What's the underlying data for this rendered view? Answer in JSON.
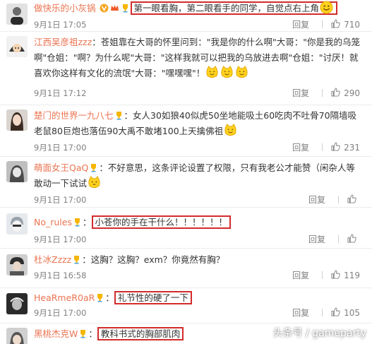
{
  "reply_label": "回复",
  "watermark": "头条号 / gameparty",
  "colors": {
    "username": "#eb7350",
    "highlight_box": "#d32b2b",
    "meta_text": "#808080"
  },
  "comments": [
    {
      "username": "做快乐的小灰锅",
      "separator": " ",
      "prefix": "",
      "text_part": "第一眼看胸，第二眼看手的同学，自觉点右上角",
      "text_rest": "",
      "time": "9月1日 17:05",
      "likes": "710"
    },
    {
      "username": "江西吴彦祖zzz",
      "separator": "：",
      "prefix": "",
      "text_part": "",
      "text_rest": "苍姐靠在大哥的怀里问到：\"我是你的什么啊\"大哥：\"你是我的乌笼啊\"仓姐：\"啊？为什么呢\"大哥：\"这样我就可以把我的乌放进去啊\"仓姐：\"讨厌！就喜欢你这样有文化的流氓\"大哥：\"嘿嘿嘿\"！",
      "time": "9月1日 17:12",
      "likes": "290"
    },
    {
      "username": "楚门的世界一九八七",
      "separator": "：",
      "prefix": "",
      "text_part": "",
      "text_rest": "女人30如狼40似虎50坐地能吸土60吃肉不吐骨70隔墙吸老鼠80巨炮也落伍90大禹不敢堵100上天擒佛祖",
      "time": "9月1日 17:00",
      "likes": "231"
    },
    {
      "username": "萌面女王QaQ",
      "separator": "：",
      "prefix": "",
      "text_part": "",
      "text_rest": "不好意思，这条评论设置了权限，只有我老公才能赞（闲杂人等敢动一下试试",
      "time": "9月1日 17:00",
      "likes": ""
    },
    {
      "username": "No_rules",
      "separator": "：",
      "prefix": "",
      "text_part": "小苍你的手在干什么！！！！！！",
      "text_rest": "",
      "time": "9月1日 17:00",
      "likes": ""
    },
    {
      "username": "杜冰Zzzz",
      "separator": "：",
      "prefix": "",
      "text_part": "",
      "text_rest": "这胸？这胸？exm？你竟然有胸？",
      "time": "9月1日 16:58",
      "likes": "119"
    },
    {
      "username": "HeaRmeR0aR",
      "separator": "：",
      "prefix": "",
      "text_part": "礼节性的硬了一下",
      "text_rest": "",
      "time": "9月1日 17:00",
      "likes": "105"
    },
    {
      "username": "黑桃杰克W",
      "separator": "：",
      "prefix": "",
      "text_part": "教科书式的胸部肌肉",
      "text_rest": "",
      "time": "",
      "likes": ""
    }
  ]
}
